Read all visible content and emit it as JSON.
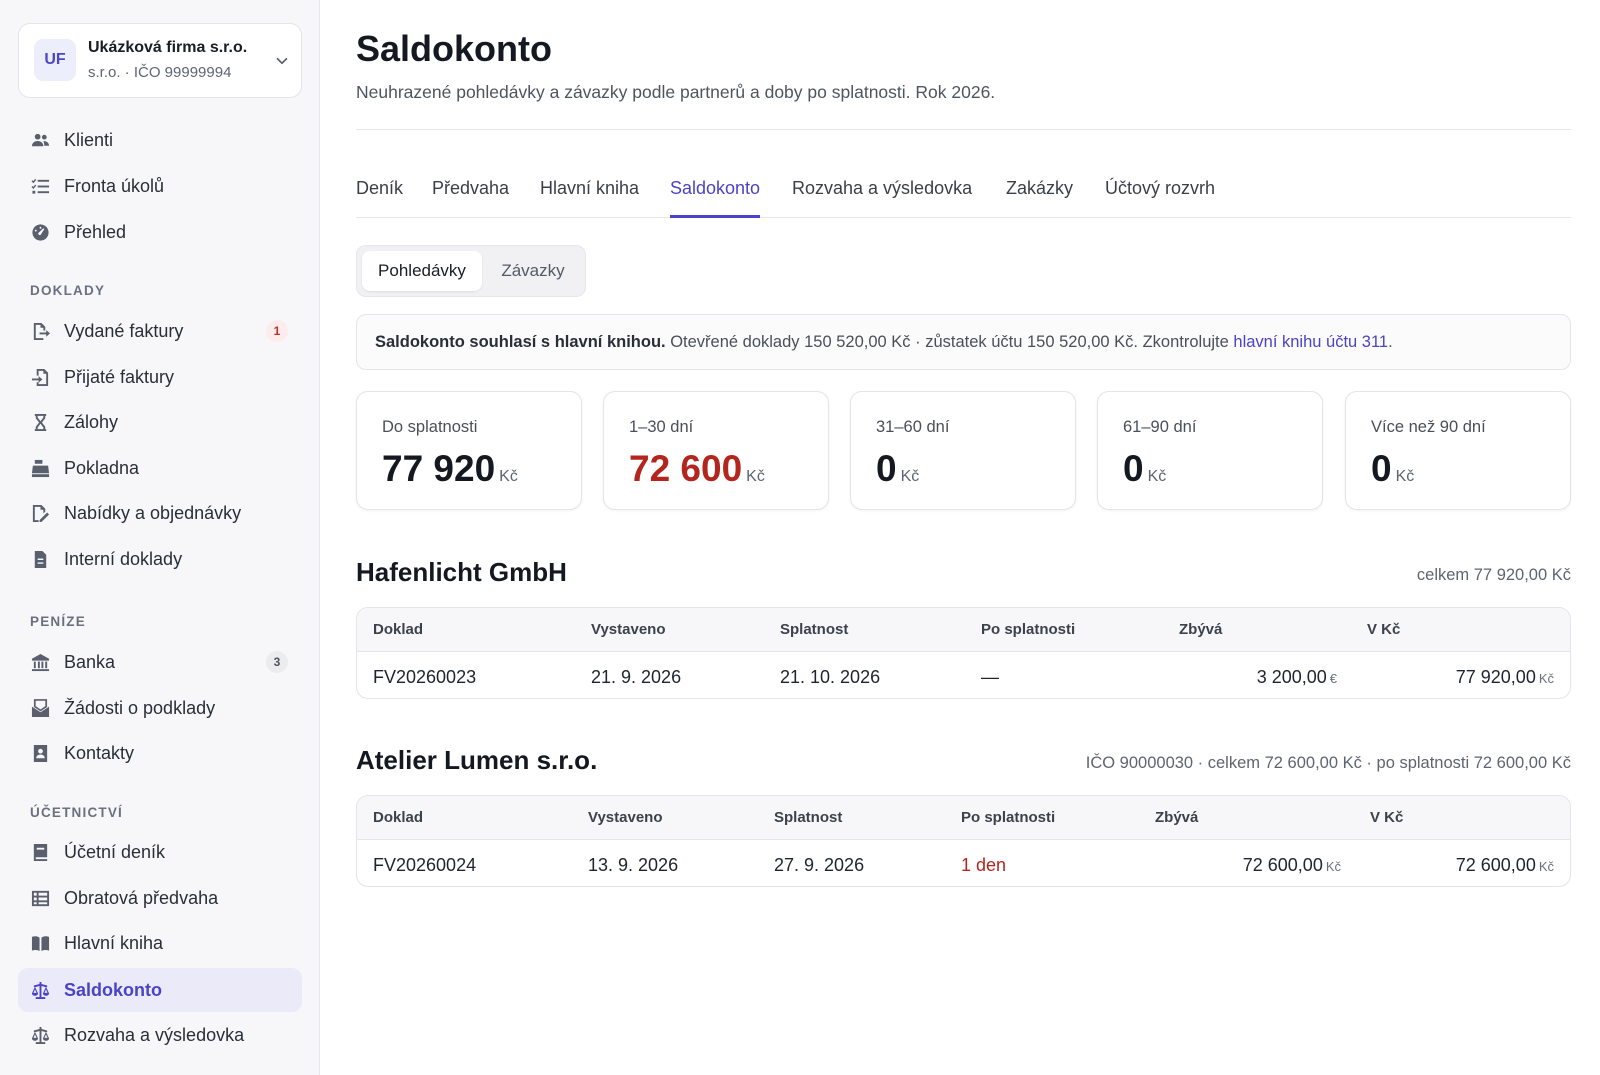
{
  "company": {
    "initials": "UF",
    "name": "Ukázková firma s.r.o.",
    "sub": "s.r.o. · IČO 99999994"
  },
  "nav_top": [
    {
      "label": "Klienti",
      "icon": "users-icon"
    },
    {
      "label": "Fronta úkolů",
      "icon": "task-list-icon"
    },
    {
      "label": "Přehled",
      "icon": "dashboard-icon"
    }
  ],
  "sections": {
    "doklady": "DOKLADY",
    "penize": "PENÍZE",
    "ucetnictvi": "ÚČETNICTVÍ"
  },
  "nav_doklady": [
    {
      "label": "Vydané faktury",
      "icon": "invoice-out-icon",
      "badge": "1"
    },
    {
      "label": "Přijaté faktury",
      "icon": "invoice-in-icon"
    },
    {
      "label": "Zálohy",
      "icon": "hourglass-icon"
    },
    {
      "label": "Pokladna",
      "icon": "cash-register-icon"
    },
    {
      "label": "Nabídky a objednávky",
      "icon": "offer-icon"
    },
    {
      "label": "Interní doklady",
      "icon": "document-icon"
    }
  ],
  "nav_penize": [
    {
      "label": "Banka",
      "icon": "bank-icon",
      "badge": "3"
    },
    {
      "label": "Žádosti o podklady",
      "icon": "mail-request-icon"
    },
    {
      "label": "Kontakty",
      "icon": "contacts-icon"
    }
  ],
  "nav_ucetnictvi": [
    {
      "label": "Účetní deník",
      "icon": "journal-icon"
    },
    {
      "label": "Obratová předvaha",
      "icon": "table-icon"
    },
    {
      "label": "Hlavní kniha",
      "icon": "book-icon"
    },
    {
      "label": "Saldokonto",
      "icon": "scale-icon",
      "active": true
    },
    {
      "label": "Rozvaha a výsledovka",
      "icon": "balance-icon"
    }
  ],
  "page": {
    "title": "Saldokonto",
    "subtitle": "Neuhrazené pohledávky a závazky podle partnerů a doby po splatnosti. Rok 2026."
  },
  "tabs": [
    "Deník",
    "Předvaha",
    "Hlavní kniha",
    "Saldokonto",
    "Rozvaha a výsledovka",
    "Zakázky",
    "Účtový rozvrh"
  ],
  "active_tab": "Saldokonto",
  "segments": {
    "left": "Pohledávky",
    "right": "Závazky"
  },
  "notice": {
    "bold": "Saldokonto souhlasí s hlavní knihou.",
    "text": " Otevřené doklady 150 520,00 Kč · zůstatek účtu 150 520,00 Kč. Zkontrolujte ",
    "link": "hlavní knihu účtu 311",
    "tail": "."
  },
  "buckets": [
    {
      "label": "Do splatnosti",
      "value": "77 920",
      "currency": "Kč",
      "overdue": false
    },
    {
      "label": "1–30 dní",
      "value": "72 600",
      "currency": "Kč",
      "overdue": true
    },
    {
      "label": "31–60 dní",
      "value": "0",
      "currency": "Kč",
      "overdue": false
    },
    {
      "label": "61–90 dní",
      "value": "0",
      "currency": "Kč",
      "overdue": false
    },
    {
      "label": "Více než 90 dní",
      "value": "0",
      "currency": "Kč",
      "overdue": false
    }
  ],
  "columns": [
    "Doklad",
    "Vystaveno",
    "Splatnost",
    "Po splatnosti",
    "Zbývá",
    "V Kč"
  ],
  "groups": [
    {
      "name": "Hafenlicht GmbH",
      "meta": "celkem 77 920,00 Kč",
      "rows": [
        {
          "doc": "FV20260023",
          "issued": "21. 9. 2026",
          "due": "21. 10. 2026",
          "overdue": "—",
          "remaining": "3 200,00",
          "remaining_cur": "€",
          "czk": "77 920,00",
          "czk_cur": "Kč"
        }
      ]
    },
    {
      "name": "Atelier Lumen s.r.o.",
      "meta": "IČO 90000030 · celkem 72 600,00 Kč · po splatnosti 72 600,00 Kč",
      "rows": [
        {
          "doc": "FV20260024",
          "issued": "13. 9. 2026",
          "due": "27. 9. 2026",
          "overdue": "1 den",
          "remaining": "72 600,00",
          "remaining_cur": "Kč",
          "czk": "72 600,00",
          "czk_cur": "Kč"
        }
      ]
    }
  ],
  "colors": {
    "accent": "#4a43c9",
    "danger": "#b3261e"
  }
}
